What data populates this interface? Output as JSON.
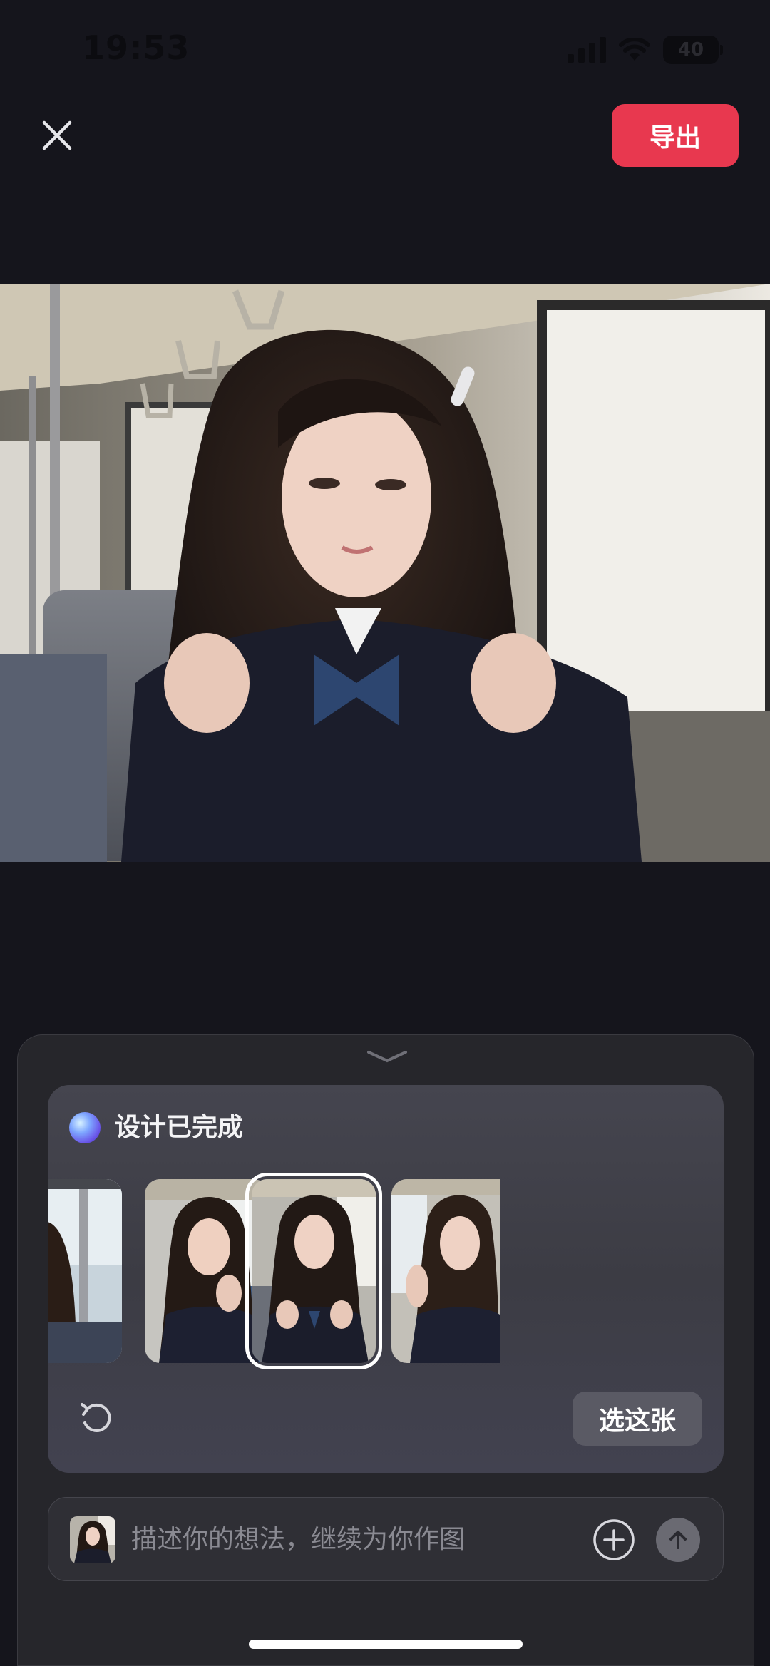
{
  "status_bar": {
    "time": "19:53",
    "battery": "40"
  },
  "header": {
    "close_icon": "close-icon",
    "export_label": "导出",
    "accent_color": "#e8384f"
  },
  "result_card": {
    "status_title": "设计已完成",
    "thumbnails": [
      {
        "name": "thumb-1",
        "selected": false
      },
      {
        "name": "thumb-2",
        "selected": false
      },
      {
        "name": "thumb-3",
        "selected": true
      },
      {
        "name": "thumb-4",
        "selected": false
      }
    ],
    "refresh_icon": "refresh-icon",
    "choose_label": "选这张"
  },
  "input_bar": {
    "placeholder": "描述你的想法，继续为你作图",
    "plus_icon": "plus-circle-icon",
    "send_icon": "send-arrow-icon"
  }
}
